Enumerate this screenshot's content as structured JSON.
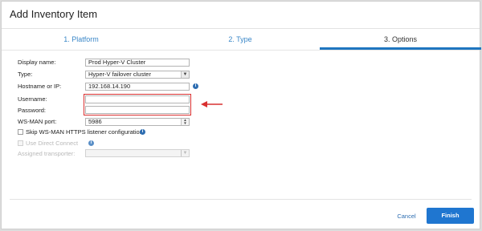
{
  "dialog": {
    "title": "Add Inventory Item"
  },
  "steps": [
    {
      "label": "1. Platform"
    },
    {
      "label": "2. Type"
    },
    {
      "label": "3. Options"
    }
  ],
  "form": {
    "display_name": {
      "label": "Display name:",
      "value": "Prod Hyper-V Cluster"
    },
    "type": {
      "label": "Type:",
      "value": "Hyper-V failover cluster"
    },
    "hostname": {
      "label": "Hostname or IP:",
      "value": "192.168.14.190"
    },
    "username": {
      "label": "Username:",
      "value": ""
    },
    "password": {
      "label": "Password:",
      "value": ""
    },
    "wsman_port": {
      "label": "WS-MAN port:",
      "value": "5986"
    },
    "skip_https": {
      "label": "Skip WS-MAN HTTPS listener configuration"
    },
    "direct_connect": {
      "label": "Use Direct Connect"
    },
    "transporter": {
      "label": "Assigned transporter:",
      "value": ""
    }
  },
  "footer": {
    "cancel_label": "Cancel",
    "finish_label": "Finish"
  },
  "colors": {
    "accent": "#1f76d0",
    "highlight_box": "#d93030"
  }
}
